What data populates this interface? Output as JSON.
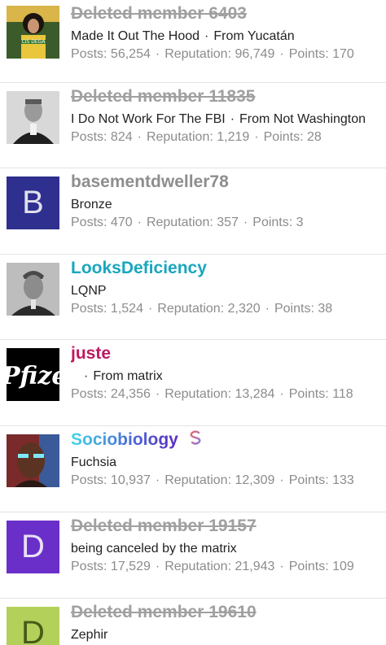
{
  "labels": {
    "posts": "Posts:",
    "reputation": "Reputation:",
    "points": "Points:",
    "separator": "·"
  },
  "members": [
    {
      "name": "Deleted member 6403",
      "title": "Made It Out The Hood",
      "location": "From Yucatán",
      "posts": "56,254",
      "reputation": "96,749",
      "points": "170",
      "avatar_caption": "CIS DEGA"
    },
    {
      "name": "Deleted member 11835",
      "title": "I Do Not Work For The FBI",
      "location": "From Not Washington",
      "posts": "824",
      "reputation": "1,219",
      "points": "28"
    },
    {
      "name": "basementdweller78",
      "title": "Bronze",
      "posts": "470",
      "reputation": "357",
      "points": "3",
      "avatar_letter": "B",
      "avatar_color": "#2e2f8e"
    },
    {
      "name": "LooksDeficiency",
      "title": "LQNP",
      "posts": "1,524",
      "reputation": "2,320",
      "points": "38"
    },
    {
      "name": "juste",
      "title": "",
      "location": "From matrix",
      "posts": "24,356",
      "reputation": "13,284",
      "points": "118",
      "avatar_text": "Pfize"
    },
    {
      "name": "Sociobiology",
      "badge_icon": "dollar-sign-icon",
      "title": "Fuchsia",
      "posts": "10,937",
      "reputation": "12,309",
      "points": "133"
    },
    {
      "name": "Deleted member 19157",
      "title": "being canceled by the matrix",
      "posts": "17,529",
      "reputation": "21,943",
      "points": "109",
      "avatar_letter": "D",
      "avatar_color": "#6a2fc9"
    },
    {
      "name": "Deleted member 19610",
      "title": "Zephir",
      "avatar_letter": "D",
      "avatar_color": "#b3d15a"
    }
  ]
}
